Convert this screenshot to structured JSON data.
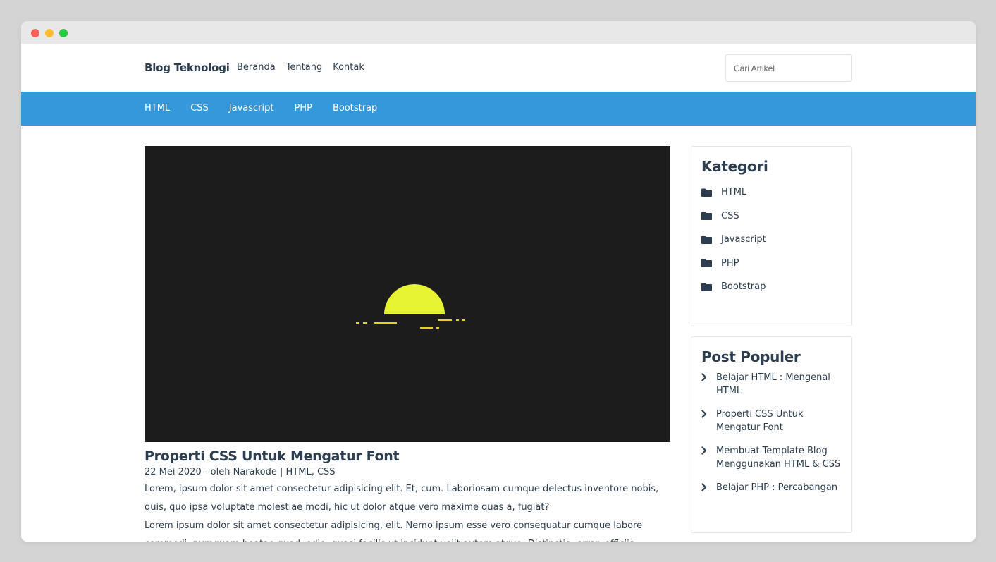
{
  "site": {
    "brand": "Blog Teknologi",
    "top_links": [
      "Beranda",
      "Tentang",
      "Kontak"
    ],
    "search_placeholder": "Cari Artikel"
  },
  "categories_bar": [
    "HTML",
    "CSS",
    "Javascript",
    "PHP",
    "Bootstrap"
  ],
  "post": {
    "title": "Properti CSS Untuk Mengatur Font",
    "meta": "22 Mei 2020 - oleh Narakode | HTML, CSS",
    "paragraphs": [
      "Lorem, ipsum dolor sit amet consectetur adipisicing elit. Et, cum. Laboriosam cumque delectus inventore nobis, quis, quo ipsa voluptate molestiae modi, hic ut dolor atque vero maxime quas a, fugiat?",
      "Lorem ipsum dolor sit amet consectetur adipisicing, elit. Nemo ipsum esse vero consequatur cumque labore commodi, numquam beatae quod, odio, quasi facilis ut incidunt velit autem atque. Distinctio, error, officiis."
    ],
    "hero_colors": {
      "background": "#1c1c1c",
      "sun": "#e6f432",
      "lines": "#e6d21e"
    }
  },
  "sidebar": {
    "kategori": {
      "title": "Kategori",
      "items": [
        "HTML",
        "CSS",
        "Javascript",
        "PHP",
        "Bootstrap"
      ],
      "icon": "folder-icon"
    },
    "populer": {
      "title": "Post Populer",
      "items": [
        "Belajar HTML : Mengenal HTML",
        "Properti CSS Untuk Mengatur Font",
        "Membuat Template Blog Menggunakan HTML & CSS",
        "Belajar PHP : Percabangan"
      ],
      "icon": "chevron-right-icon"
    }
  },
  "colors": {
    "accent": "#3498db",
    "text": "#2c3e50"
  }
}
